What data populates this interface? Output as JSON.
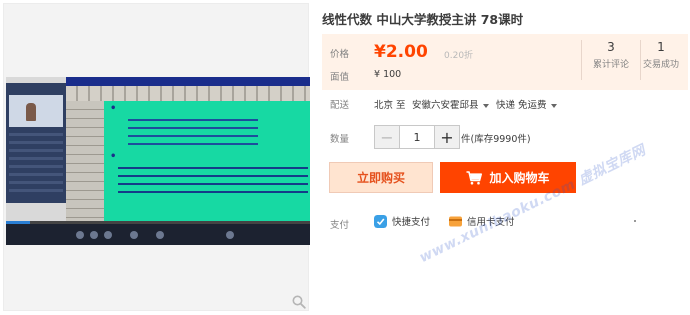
{
  "product": {
    "title": "线性代数 中山大学教授主讲 78课时"
  },
  "price": {
    "label": "价格",
    "value": "¥2.00",
    "discount": "0.20折",
    "orig_label": "面值",
    "orig_value": "¥ 100"
  },
  "stats": [
    {
      "num": "3",
      "label": "累计评论"
    },
    {
      "num": "1",
      "label": "交易成功"
    }
  ],
  "shipping": {
    "label": "配送",
    "from_to": "北京 至",
    "region": "安徽六安霍邱县",
    "method": "快递 免运费"
  },
  "quantity": {
    "label": "数量",
    "value": "1",
    "minus": "−",
    "plus": "+",
    "stock": "件(库存9990件)"
  },
  "buttons": {
    "buy_now": "立即购买",
    "add_cart": "加入购物车"
  },
  "payment": {
    "label": "支付",
    "methods": [
      "快捷支付",
      "信用卡支付"
    ]
  },
  "media": {
    "playback_progress": 0.08
  },
  "watermark": "www.xunibaoku.com 虚拟宝库网",
  "colors": {
    "accent": "#ff4400",
    "price_bg": "#fff2e8",
    "buy_bg": "#ffe4d0"
  },
  "icons": [
    "zoom-icon",
    "cart-icon",
    "quickpay-icon",
    "creditcard-icon",
    "caret-down-icon"
  ]
}
